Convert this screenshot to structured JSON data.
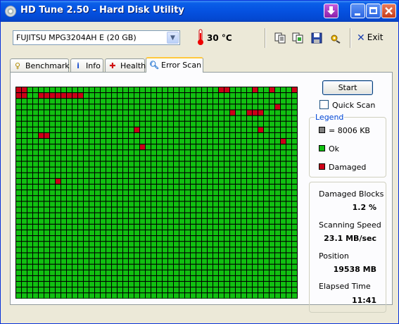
{
  "window": {
    "title": "HD Tune 2.50 - Hard Disk Utility"
  },
  "toolbar": {
    "drive": "FUJITSU MPG3204AH  E (20 GB)",
    "temperature": "30 °C",
    "exit_label": "Exit",
    "icons": [
      "copy-text-icon",
      "copy-screenshot-icon",
      "save-icon",
      "options-icon",
      "exit-icon"
    ]
  },
  "tabs": [
    {
      "label": "Benchmark",
      "icon": "benchmark-icon",
      "active": false
    },
    {
      "label": "Info",
      "icon": "info-icon",
      "active": false
    },
    {
      "label": "Health",
      "icon": "health-icon",
      "active": false
    },
    {
      "label": "Error Scan",
      "icon": "magnifier-icon",
      "active": true
    }
  ],
  "controls": {
    "start_label": "Start",
    "quick_scan_label": "Quick Scan",
    "quick_scan_checked": false
  },
  "legend": {
    "title": "Legend",
    "block_size": "= 8006 KB",
    "ok_label": "Ok",
    "damaged_label": "Damaged",
    "colors": {
      "block": "#808080",
      "ok": "#11c011",
      "damaged": "#cc0018"
    }
  },
  "stats": {
    "damaged_blocks_label": "Damaged Blocks",
    "damaged_blocks_value": "1.2 %",
    "scanning_speed_label": "Scanning Speed",
    "scanning_speed_value": "23.1 MB/sec",
    "position_label": "Position",
    "position_value": "19538 MB",
    "elapsed_label": "Elapsed Time",
    "elapsed_value": "11:41"
  },
  "scan_grid": {
    "columns": 50,
    "rows": 37,
    "damaged_cells": [
      [
        0,
        0
      ],
      [
        1,
        0
      ],
      [
        0,
        1
      ],
      [
        1,
        1
      ],
      [
        4,
        1
      ],
      [
        5,
        1
      ],
      [
        6,
        1
      ],
      [
        7,
        1
      ],
      [
        8,
        1
      ],
      [
        9,
        1
      ],
      [
        10,
        1
      ],
      [
        11,
        1
      ],
      [
        36,
        0
      ],
      [
        37,
        0
      ],
      [
        42,
        0
      ],
      [
        45,
        0
      ],
      [
        49,
        0
      ],
      [
        46,
        3
      ],
      [
        38,
        4
      ],
      [
        41,
        4
      ],
      [
        42,
        4
      ],
      [
        43,
        4
      ],
      [
        21,
        7
      ],
      [
        43,
        7
      ],
      [
        4,
        8
      ],
      [
        5,
        8
      ],
      [
        47,
        9
      ],
      [
        22,
        10
      ],
      [
        7,
        16
      ]
    ]
  }
}
